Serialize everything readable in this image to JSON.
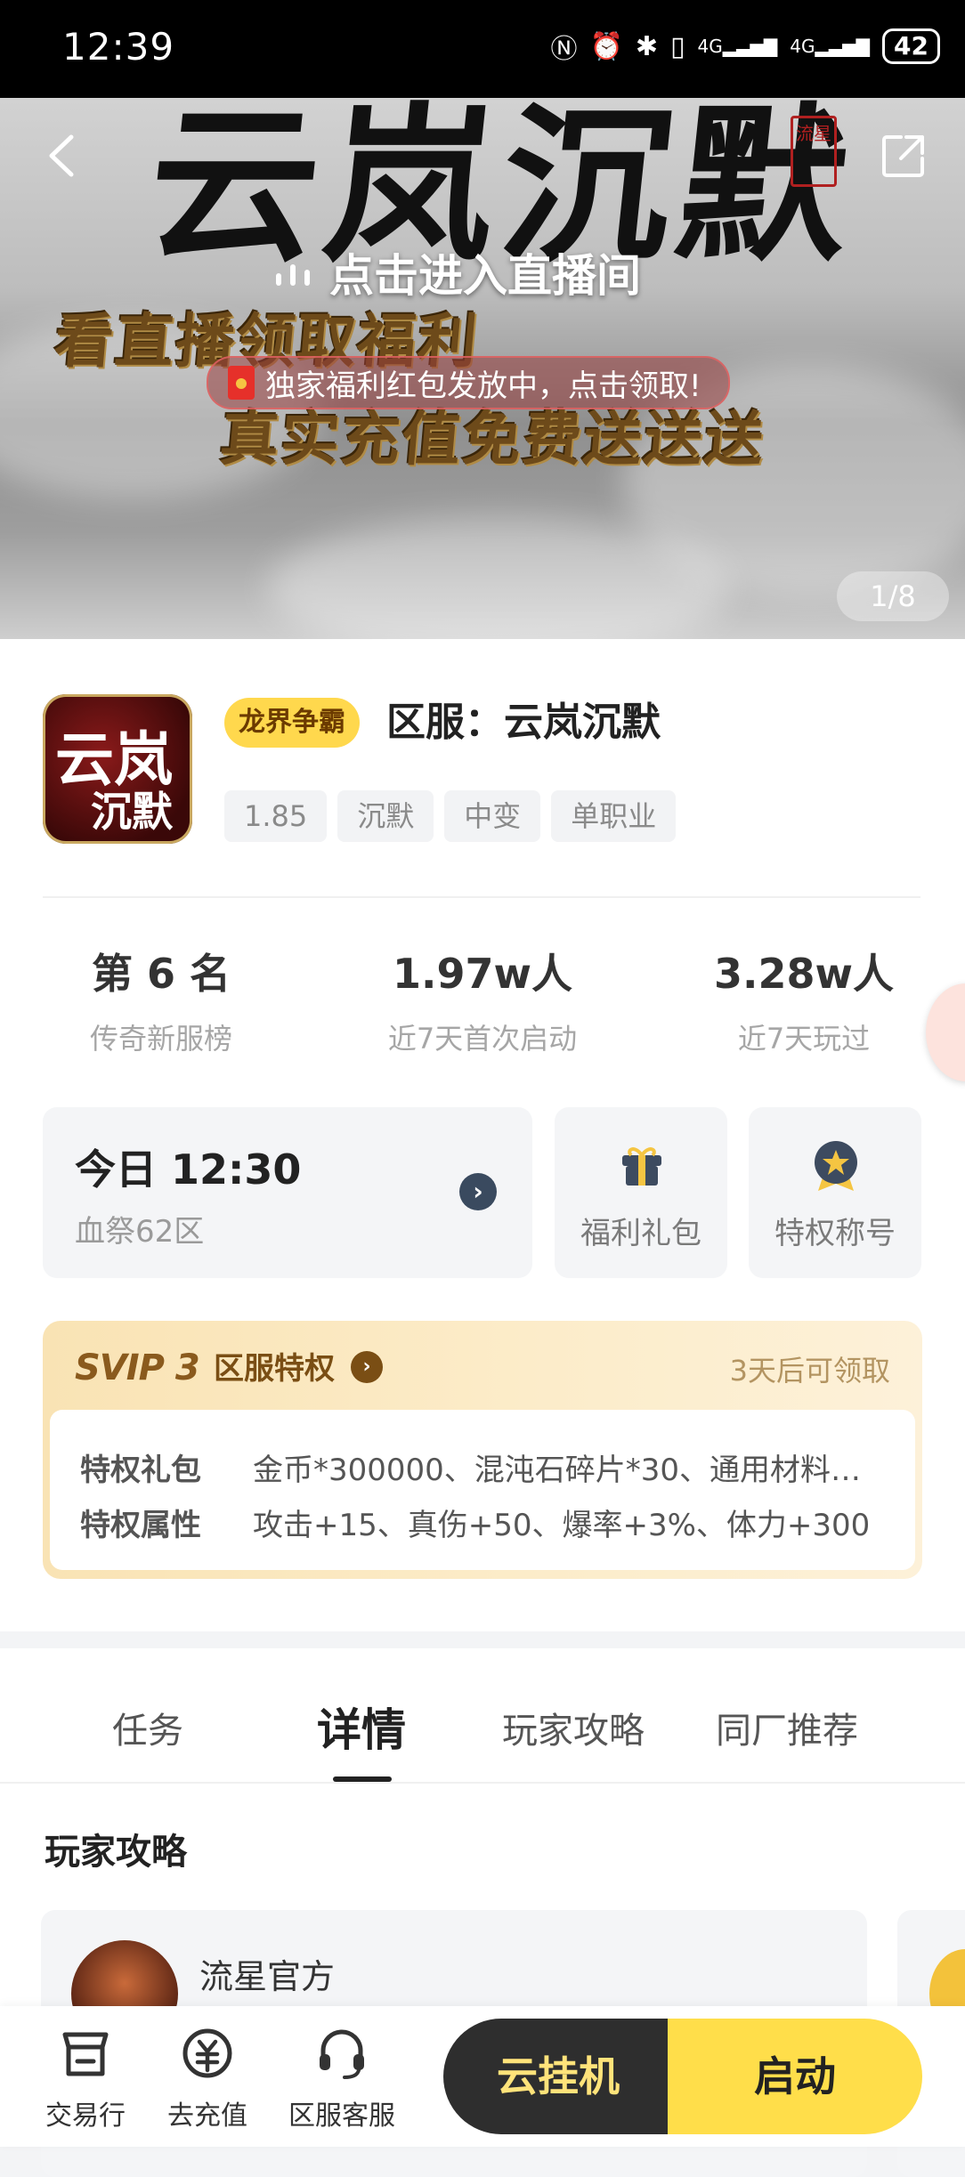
{
  "status_bar": {
    "time": "12:39",
    "battery": "42",
    "network": "4G"
  },
  "banner": {
    "title": "云岚沉默",
    "seal": "流星",
    "live_text": "点击进入直播间",
    "promo_line1": "看直播领取福利",
    "promo_line2": "真实充值免费送送送",
    "redpacket_text": "独家福利红包发放中，点击领取!",
    "pager": "1/8"
  },
  "game": {
    "icon_text_top": "云岚",
    "icon_text_bottom": "沉默",
    "badge": "龙界争霸",
    "title": "区服：云岚沉默",
    "tags": [
      "1.85",
      "沉默",
      "中变",
      "单职业"
    ]
  },
  "stats": [
    {
      "value": "第 6 名",
      "label": "传奇新服榜"
    },
    {
      "value": "1.97w人",
      "label": "近7天首次启动"
    },
    {
      "value": "3.28w人",
      "label": "近7天玩过"
    }
  ],
  "server": {
    "time": "今日 12:30",
    "name": "血祭62区"
  },
  "quick": [
    {
      "label": "福利礼包",
      "icon": "gift-icon"
    },
    {
      "label": "特权称号",
      "icon": "medal-icon"
    }
  ],
  "svip": {
    "logo": "SVIP 3",
    "title": "区服特权",
    "later": "3天后可领取",
    "rows": [
      {
        "key": "特权礼包",
        "value": "金币*300000、混沌石碎片*30、通用材料…"
      },
      {
        "key": "特权属性",
        "value": "攻击+15、真伤+50、爆率+3%、体力+300"
      }
    ]
  },
  "tabs": [
    {
      "label": "任务",
      "active": false
    },
    {
      "label": "详情",
      "active": true
    },
    {
      "label": "玩家攻略",
      "active": false
    },
    {
      "label": "同厂推荐",
      "active": false
    }
  ],
  "guide": {
    "title": "玩家攻略",
    "author": "流星官方"
  },
  "bottom_nav": [
    {
      "label": "交易行",
      "icon": "shop-icon"
    },
    {
      "label": "去充值",
      "icon": "recharge-icon"
    },
    {
      "label": "区服客服",
      "icon": "headset-icon"
    }
  ],
  "actions": {
    "cloud": "云挂机",
    "start": "启动"
  },
  "colors": {
    "accent_yellow": "#ffde4a",
    "dark": "#2e2e2e",
    "svip_gold": "#7a4e14"
  }
}
